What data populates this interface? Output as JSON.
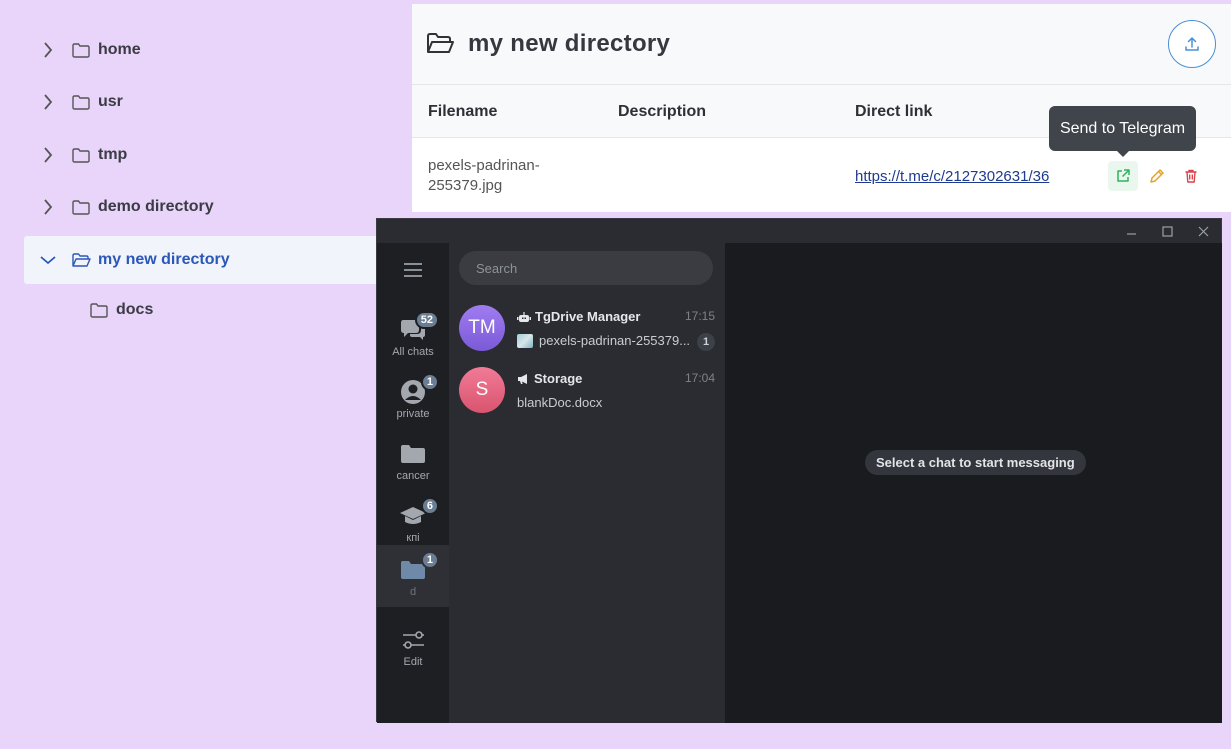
{
  "tree": {
    "items": [
      {
        "label": "home"
      },
      {
        "label": "usr"
      },
      {
        "label": "tmp"
      },
      {
        "label": "demo directory"
      },
      {
        "label": "my new directory"
      },
      {
        "label": "docs"
      }
    ]
  },
  "header": {
    "title": "my new directory"
  },
  "table": {
    "columns": [
      "Filename",
      "Description",
      "Direct link"
    ],
    "rows": [
      {
        "filename_line1": "pexels-padrinan-",
        "filename_line2": "255379.jpg",
        "description": "",
        "link": "https://t.me/c/2127302631/36"
      }
    ]
  },
  "tooltip": {
    "text": "Send to Telegram"
  },
  "telegram": {
    "search_placeholder": "Search",
    "rail": [
      {
        "label": "All chats",
        "badge": "52"
      },
      {
        "label": "private",
        "badge": "1"
      },
      {
        "label": "cancer",
        "badge": ""
      },
      {
        "label": "кпі",
        "badge": "6"
      },
      {
        "label": "d",
        "badge": "1"
      },
      {
        "label": "Edit",
        "badge": ""
      }
    ],
    "chats": [
      {
        "initials": "TM",
        "name": "TgDrive Manager",
        "time": "17:15",
        "preview": "pexels-padrinan-255379...",
        "unread": "1",
        "color_top": "#a07cf0",
        "color_bottom": "#7b5ad8"
      },
      {
        "initials": "S",
        "name": "Storage",
        "time": "17:04",
        "preview": "blankDoc.docx",
        "unread": "",
        "color_top": "#f17b97",
        "color_bottom": "#d9546f"
      }
    ],
    "empty_state": "Select a chat to start messaging"
  },
  "colors": {
    "accent": "#2b57b8",
    "background": "#e8d5f9",
    "send_green": "#2fb35a",
    "edit_orange": "#e6a22a",
    "delete_red": "#d9434a"
  }
}
